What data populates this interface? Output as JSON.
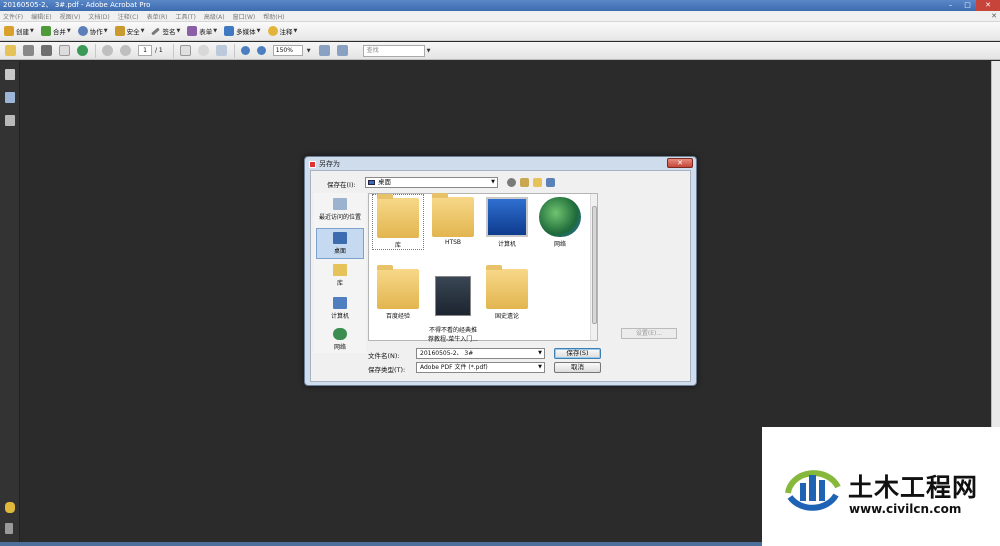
{
  "window": {
    "title": "20160505-2、 3#.pdf - Adobe Acrobat Pro"
  },
  "menu": [
    "文件(F)",
    "编辑(E)",
    "视图(V)",
    "文档(D)",
    "注释(C)",
    "表单(R)",
    "工具(T)",
    "高级(A)",
    "窗口(W)",
    "帮助(H)"
  ],
  "toolbar": {
    "create": "创建",
    "combine": "合并",
    "collaborate": "协作",
    "secure": "安全",
    "sign": "签名",
    "forms": "表单",
    "multimedia": "多媒体",
    "comment": "注释"
  },
  "nav": {
    "page": "1",
    "total": "/ 1",
    "zoom": "150%",
    "find_placeholder": "查找"
  },
  "colors": {
    "titlebar": "#3c6bb0",
    "canvas": "#2b2b2b",
    "close": "#c5473a"
  },
  "dialog": {
    "title": "另存为",
    "close": "✕",
    "save_in_label": "保存在(I):",
    "save_in_value": "桌面",
    "places": [
      "最近访问的位置",
      "桌面",
      "库",
      "计算机",
      "网络"
    ],
    "files": [
      {
        "name": "库",
        "icon": "library-icon"
      },
      {
        "name": "HTSB",
        "icon": "user-folder-icon"
      },
      {
        "name": "计算机",
        "icon": "computer-icon"
      },
      {
        "name": "网络",
        "icon": "network-icon"
      },
      {
        "name": "百度经验",
        "icon": "folder-icon"
      },
      {
        "name": "不得不看的经典推\n荐教程-菜牛入门...",
        "icon": "pdf-file-icon"
      },
      {
        "name": "国史遗论",
        "icon": "shortcut-folder-icon"
      }
    ],
    "settings": "设置(E)...",
    "filename_label": "文件名(N):",
    "filename_value": "20160505-2、 3#",
    "filetype_label": "保存类型(T):",
    "filetype_value": "Adobe PDF 文件 (*.pdf)",
    "save": "保存(S)",
    "cancel": "取消"
  },
  "watermark": {
    "title": "土木工程网",
    "url": "www.civilcn.com"
  }
}
